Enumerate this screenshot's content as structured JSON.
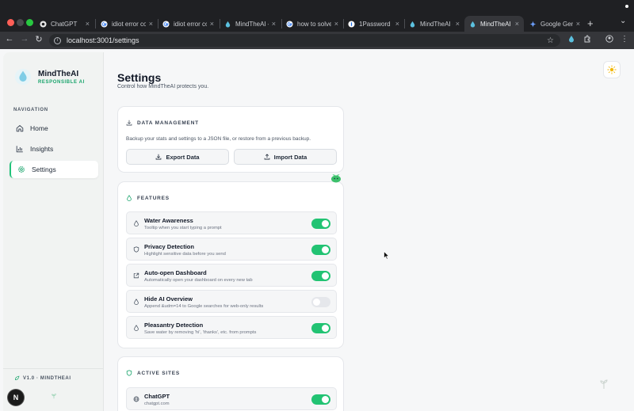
{
  "browser": {
    "tabs": [
      {
        "label": "ChatGPT",
        "icon": "chatgpt-icon"
      },
      {
        "label": "idiot error co",
        "icon": "google-icon"
      },
      {
        "label": "idiot error co",
        "icon": "google-icon"
      },
      {
        "label": "MindTheAI –",
        "icon": "droplet-icon"
      },
      {
        "label": "how to solve",
        "icon": "google-icon"
      },
      {
        "label": "1Password",
        "icon": "onepassword-icon"
      },
      {
        "label": "MindTheAI –",
        "icon": "droplet-icon"
      },
      {
        "label": "MindTheAI –",
        "icon": "droplet-icon"
      },
      {
        "label": "Google Gemi",
        "icon": "gemini-icon"
      }
    ],
    "url": "localhost:3001/settings"
  },
  "sidebar": {
    "brand_name": "MindTheAI",
    "brand_sub": "RESPONSIBLE AI",
    "nav_heading": "NAVIGATION",
    "items": [
      {
        "label": "Home",
        "icon": "home-icon"
      },
      {
        "label": "Insights",
        "icon": "chart-icon"
      },
      {
        "label": "Settings",
        "icon": "gear-icon",
        "active": true
      }
    ],
    "version": "V1.0 · MINDTHEAI",
    "avatar_letter": "N"
  },
  "page": {
    "title": "Settings",
    "subtitle": "Control how MindTheAI protects you."
  },
  "data_management": {
    "title": "DATA MANAGEMENT",
    "description": "Backup your stats and settings to a JSON file, or restore from a previous backup.",
    "export_label": "Export Data",
    "import_label": "Import Data"
  },
  "features": {
    "title": "FEATURES",
    "items": [
      {
        "name": "Water Awareness",
        "desc": "Tooltip when you start typing a prompt",
        "on": true
      },
      {
        "name": "Privacy Detection",
        "desc": "Highlight sensitive data before you send",
        "on": true
      },
      {
        "name": "Auto-open Dashboard",
        "desc": "Automatically open your dashboard on every new tab",
        "on": true
      },
      {
        "name": "Hide AI Overview",
        "desc": "Append &udm=14 to Google searches for web-only results",
        "on": false
      },
      {
        "name": "Pleasantry Detection",
        "desc": "Save water by removing 'hi', 'thanks', etc. from prompts",
        "on": true
      }
    ]
  },
  "active_sites": {
    "title": "ACTIVE SITES",
    "items": [
      {
        "name": "ChatGPT",
        "domain": "chatgpt.com",
        "on": true
      }
    ]
  },
  "colors": {
    "accent": "#22c373",
    "brand": "#16a36a"
  }
}
